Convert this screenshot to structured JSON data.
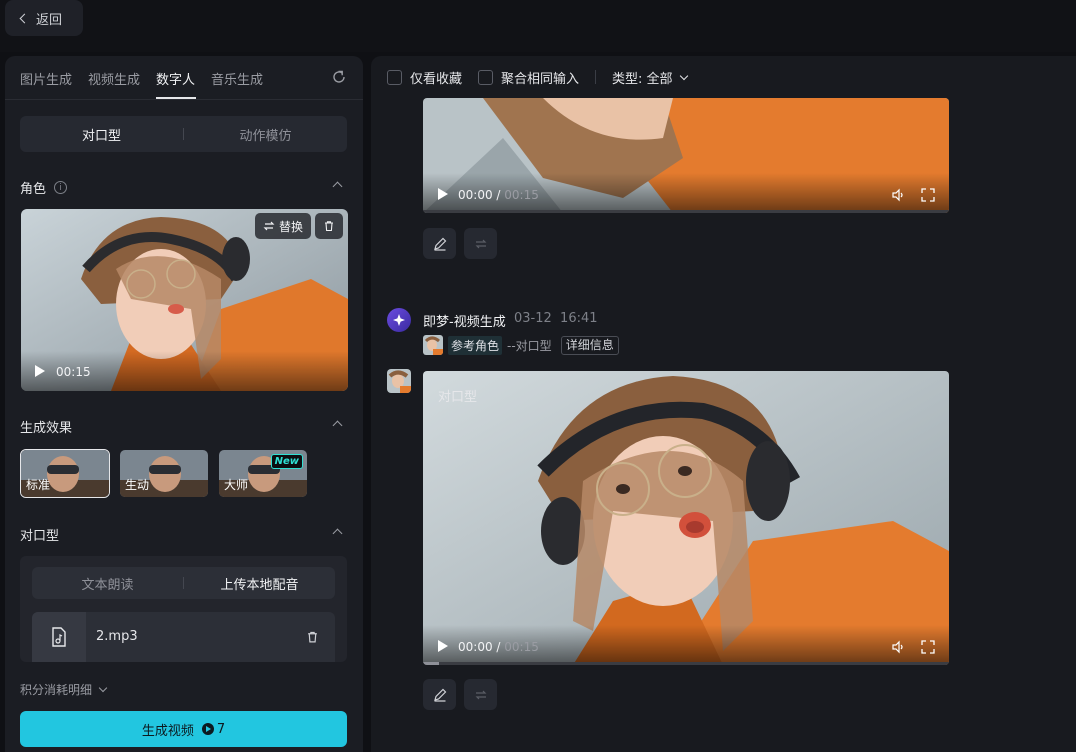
{
  "topbar": {
    "back_label": "返回"
  },
  "left": {
    "tabs": [
      "图片生成",
      "视频生成",
      "数字人",
      "音乐生成"
    ],
    "active_tab": "数字人",
    "mode_options": [
      "对口型",
      "动作模仿"
    ],
    "role": {
      "title": "角色",
      "replace_label": "替换",
      "duration": "00:15"
    },
    "effect": {
      "title": "生成效果",
      "options": [
        "标准",
        "生动",
        "大师"
      ],
      "new_badge": "New"
    },
    "lip": {
      "title": "对口型",
      "options": [
        "文本朗读",
        "上传本地配音"
      ],
      "file_name": "2.mp3"
    },
    "credits_label": "积分消耗明细",
    "generate": {
      "label": "生成视频",
      "cost": "7"
    }
  },
  "right": {
    "filters": {
      "favorites_label": "仅看收藏",
      "merge_label": "聚合相同输入",
      "type_label": "类型: 全部"
    },
    "video1": {
      "current": "00:00",
      "duration": "00:15"
    },
    "message": {
      "name": "即梦-视频生成",
      "date": "03-12",
      "time": "16:41",
      "ref_label": "参考角色",
      "ref_mode": "--对口型",
      "detail_label": "详细信息"
    },
    "video2": {
      "tag": "对口型",
      "current": "00:00",
      "duration": "00:15",
      "progress": 0.03
    }
  },
  "colors": {
    "accent": "#22c6e0",
    "new_badge": "#2fe0d4",
    "bot_avatar": "#6b4ce0"
  },
  "icons": [
    "chevron-left-icon",
    "refresh-icon",
    "info-icon",
    "chevron-up-icon",
    "swap-icon",
    "trash-icon",
    "play-icon",
    "audio-file-icon",
    "chevron-down-icon",
    "coin-icon",
    "volume-icon",
    "fullscreen-icon",
    "edit-icon",
    "regenerate-icon",
    "bot-avatar-icon"
  ]
}
